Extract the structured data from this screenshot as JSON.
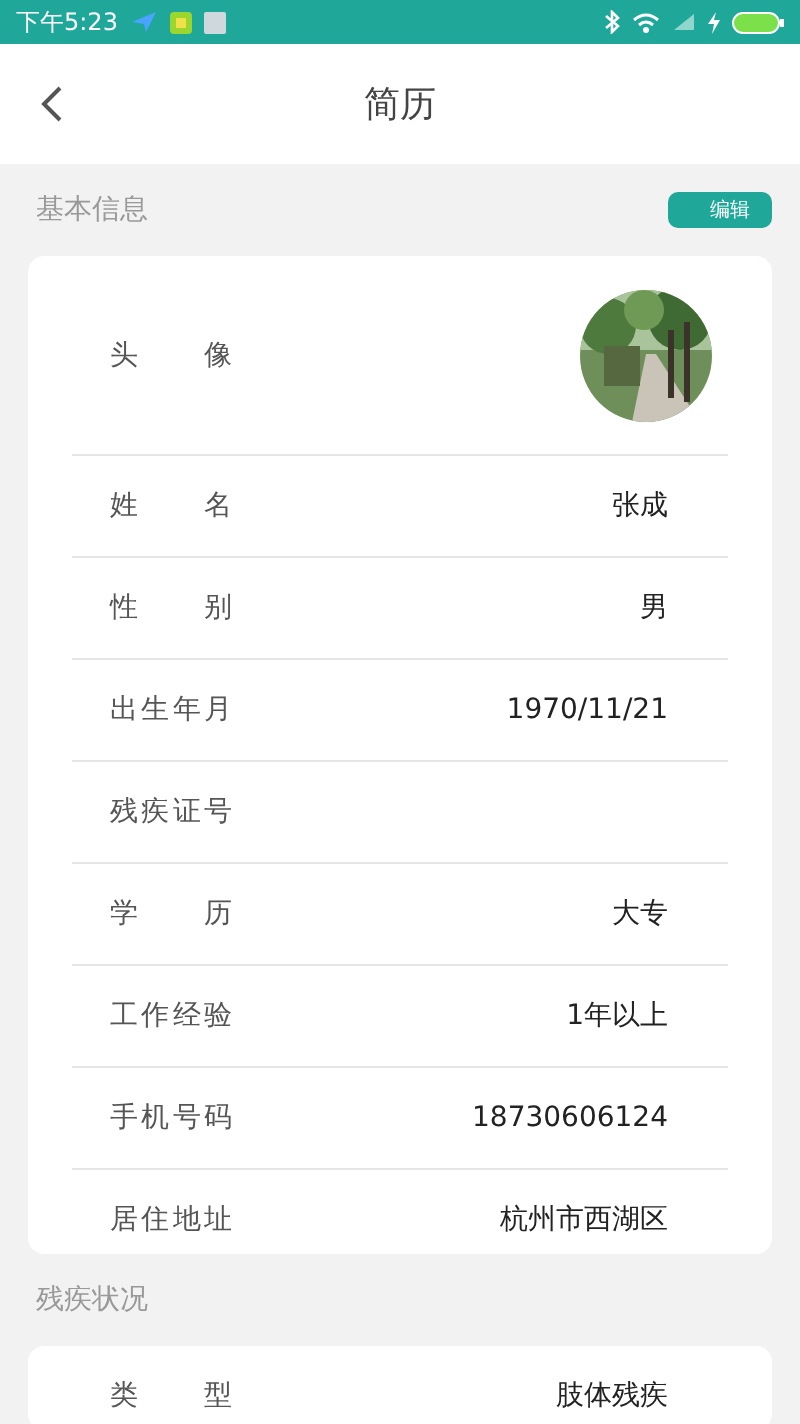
{
  "status_bar": {
    "time": "下午5:23"
  },
  "header": {
    "title": "简历"
  },
  "sections": [
    {
      "title": "基本信息",
      "action": "编辑",
      "rows": [
        {
          "kind": "avatar",
          "label": "头像"
        },
        {
          "kind": "text",
          "label": "姓名",
          "value": "张成"
        },
        {
          "kind": "text",
          "label": "性别",
          "value": "男"
        },
        {
          "kind": "text",
          "label": "出生年月",
          "value": "1970/11/21"
        },
        {
          "kind": "text",
          "label": "残疾证号"
        },
        {
          "kind": "text",
          "label": "学历",
          "value": "大专"
        },
        {
          "kind": "text",
          "label": "工作经验",
          "value": "1年以上"
        },
        {
          "kind": "text",
          "label": "手机号码",
          "value": "18730606124"
        },
        {
          "kind": "text",
          "label": "居住地址",
          "value": "杭州市西湖区"
        }
      ]
    },
    {
      "title": "残疾状况",
      "rows": [
        {
          "kind": "text",
          "label": "类型",
          "value": "肢体残疾"
        }
      ]
    }
  ]
}
